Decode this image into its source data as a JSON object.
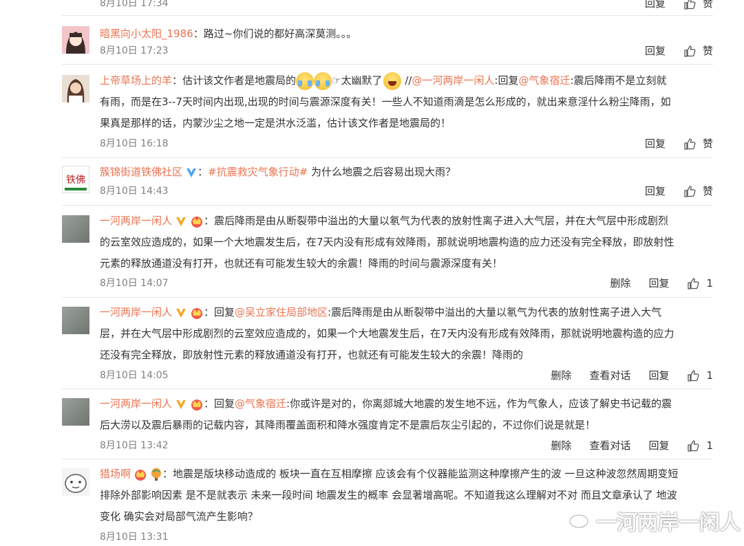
{
  "labels": {
    "reply": "回复",
    "like": "赞",
    "delete": "删除",
    "view_dialog": "查看对话"
  },
  "comments": [
    {
      "time": "8月10日 17:34",
      "like": "赞"
    },
    {
      "user": "暗黑向小太阳_1986",
      "text": "：路过~你们说的都好高深莫测。。。",
      "time": "8月10日 17:23",
      "like": "赞"
    },
    {
      "user": "上帝草场上的羊",
      "text_a": "：估计该文作者是地震局的",
      "text_b": "☞太幽默了",
      "text_c": " //",
      "ref_user": "@一河两岸一闲人",
      "text_d": ":回复",
      "ref_user2": "@气象宿迁",
      "text_e": ":震后降雨不是立刻就",
      "line2": "有雨，而是在3--7天时间内出现,出现的时间与震源深度有关！一些人不知道雨滴是怎么形成的，就出来意淫什么粉尘降雨，如",
      "line3": "果真是那样的话，内蒙沙尘之地一定是洪水泛滥，估计该文作者是地震局的！",
      "time": "8月10日 16:18",
      "like": "赞"
    },
    {
      "user": "簇锦街道铁佛社区",
      "hashtag": "#抗震救灾气象行动#",
      "text": " 为什么地震之后容易出现大雨？",
      "time": "8月10日 14:43",
      "like": "赞",
      "avatar_text": "铁佛"
    },
    {
      "user": "一河两岸一闲人",
      "text": "：震后降雨是由从断裂带中溢出的大量以氡气为代表的放射性离子进入大气层，并在大气层中形成剧烈",
      "line2": "的云室效应造成的，如果一个大地震发生后，在7天内没有形成有效降雨，那就说明地震构造的应力还没有完全释放，即放射性",
      "line3": "元素的释放通道没有打开，也就还有可能发生较大的余震！降雨的时间与震源深度有关！",
      "time": "8月10日 14:07",
      "likes": "1"
    },
    {
      "user": "一河两岸一闲人",
      "text_a": "：回复",
      "ref_user": "@吴立家住局部地区",
      "text_b": ":震后降雨是由从断裂带中溢出的大量以氡气为代表的放射性离子进入大气",
      "line2": "层，并在大气层中形成剧烈的云室效应造成的，如果一个大地震发生后，在7天内没有形成有效降雨，那就说明地震构造的应力",
      "line3": "还没有完全释放，即放射性元素的释放通道没有打开，也就还有可能发生较大的余震！降雨的",
      "time": "8月10日 14:05",
      "likes": "1"
    },
    {
      "user": "一河两岸一闲人",
      "text_a": "：回复",
      "ref_user": "@气象宿迁",
      "text_b": ":你或许是对的，你离郯城大地震的发生地不远，作为气象人，应该了解史书记载的震",
      "line2": "后大涝以及震后暴雨的记载内容，其降雨覆盖面积和降水强度肯定不是震后灰尘引起的，不过你们说是就是！",
      "time": "8月10日 13:42",
      "likes": "1"
    },
    {
      "user": "猎场啊",
      "text": "：地震是版块移动造成的 板块一直在互相摩擦 应该会有个仪器能监测这种摩擦产生的波 一旦这种波忽然周期变短",
      "line2": "排除外部影响因素 是不是就表示 未来一段时间 地震发生的概率 会显著增高呢。不知道我这么理解对不对 而且文章承认了 地波",
      "line3": "变化 确实会对局部气流产生影响？",
      "time": "8月10日 13:31"
    }
  ],
  "watermark": "一河两岸一闲人",
  "colors": {
    "accent": "#eb7350",
    "text": "#333333",
    "muted": "#808080",
    "separator": "#e6e6e6",
    "vip": "#f5a623"
  }
}
